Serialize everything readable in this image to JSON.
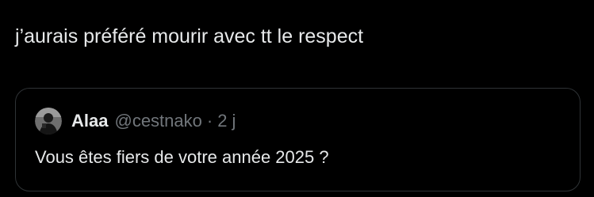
{
  "tweet": {
    "text": "j’aurais préféré mourir avec tt le respect"
  },
  "quoted_tweet": {
    "author_name": "Alaa",
    "author_handle": "@cestnako",
    "separator": "·",
    "time": "2 j",
    "text": "Vous êtes fiers de votre année 2025 ?"
  },
  "colors": {
    "background": "#000000",
    "primary_text": "#e7e9ea",
    "secondary_text": "#71767b",
    "border": "#2f3336"
  }
}
